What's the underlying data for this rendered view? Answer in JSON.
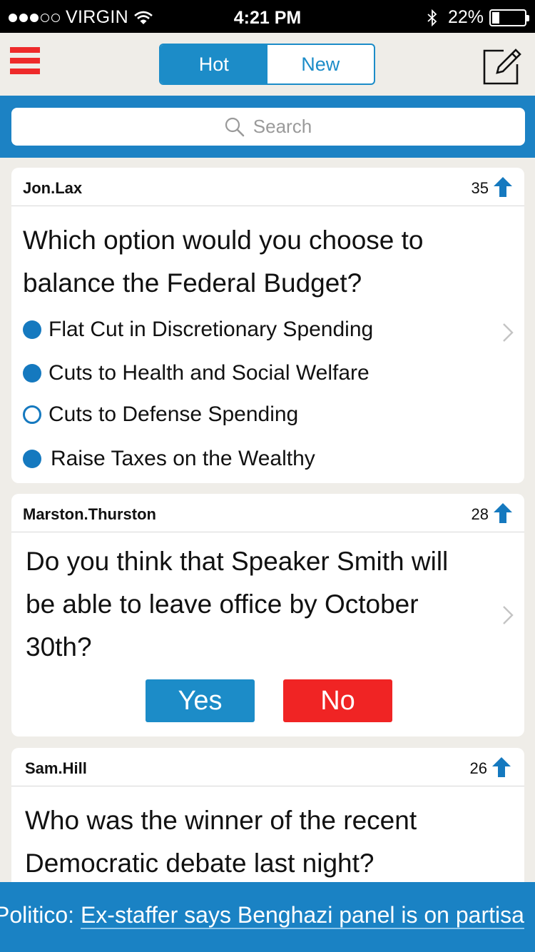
{
  "status_bar": {
    "carrier": "VIRGIN",
    "time": "4:21 PM",
    "battery_percent": "22%",
    "battery_level": 0.22,
    "signal_bars_filled": 3,
    "signal_bars_total": 5
  },
  "nav": {
    "tabs": [
      {
        "label": "Hot",
        "active": true
      },
      {
        "label": "New",
        "active": false
      }
    ],
    "menu_icon": "hamburger-icon",
    "compose_icon": "compose-icon"
  },
  "search": {
    "placeholder": "Search"
  },
  "posts": [
    {
      "username": "Jon.Lax",
      "votes": "35",
      "question": "Which option would you choose to balance the Federal Budget?",
      "options": [
        {
          "label": "Flat Cut in Discretionary Spending",
          "selected": true
        },
        {
          "label": "Cuts to Health and Social Welfare",
          "selected": true
        },
        {
          "label": "Cuts to Defense Spending",
          "selected": false
        },
        {
          "label": "Raise Taxes on the Wealthy",
          "selected": true
        }
      ]
    },
    {
      "username": "Marston.Thurston",
      "votes": "28",
      "question": "Do you think that Speaker Smith will be able to leave office by October 30th?",
      "yes_label": "Yes",
      "no_label": "No"
    },
    {
      "username": "Sam.Hill",
      "votes": "26",
      "question": "Who was the winner of the recent Democratic debate last night?"
    }
  ],
  "ticker": {
    "source": "Politico:",
    "headline": "Ex-staffer says Benghazi panel is on partisa"
  },
  "colors": {
    "accent_blue": "#1c8cc8",
    "danger_red": "#f02424",
    "menu_red": "#ee2a2a",
    "background": "#efede8"
  }
}
